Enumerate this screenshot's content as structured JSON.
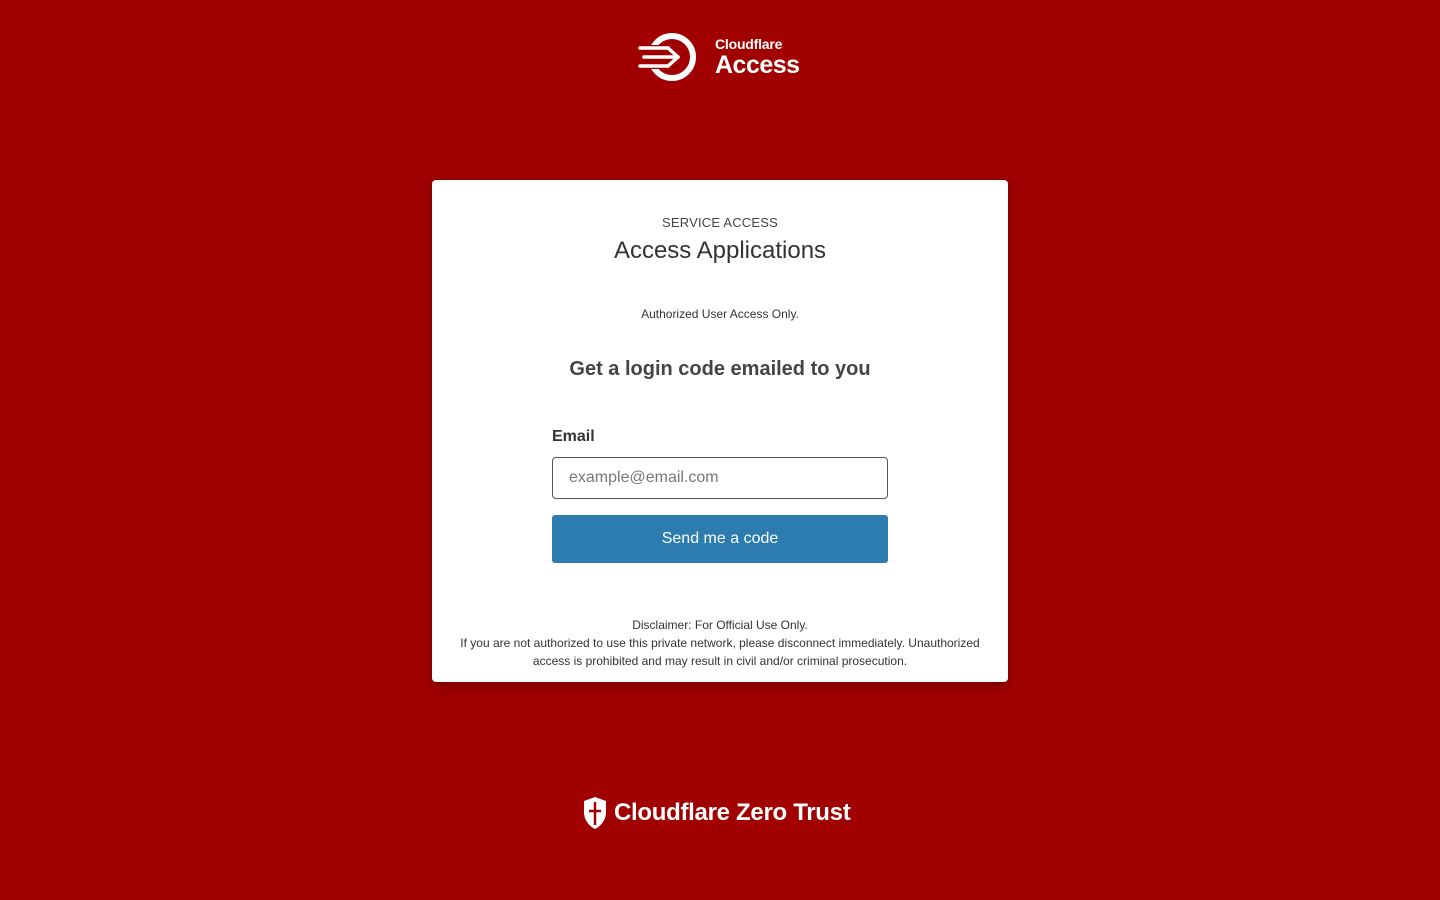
{
  "brand": {
    "top_logo_small": "Cloudflare",
    "top_logo_big": "Access",
    "footer_text": "Cloudflare Zero Trust",
    "background_color": "#a00000",
    "button_color": "#2c7cb0"
  },
  "card": {
    "eyebrow": "SERVICE ACCESS",
    "title": "Access Applications",
    "auth_message": "Authorized User Access Only.",
    "heading": "Get a login code emailed to you",
    "email_label": "Email",
    "email_value": "",
    "email_placeholder": "example@email.com",
    "send_button": "Send me a code",
    "disclaimer_line1": "Disclaimer: For Official Use Only.",
    "disclaimer_line2": "If you are not authorized to use this private network, please disconnect immediately. Unauthorized access is prohibited and may result in civil and/or criminal prosecution."
  },
  "icons": {
    "top_logo_icon": "cloudflare-access-arrow-icon",
    "footer_icon": "shield-icon"
  }
}
